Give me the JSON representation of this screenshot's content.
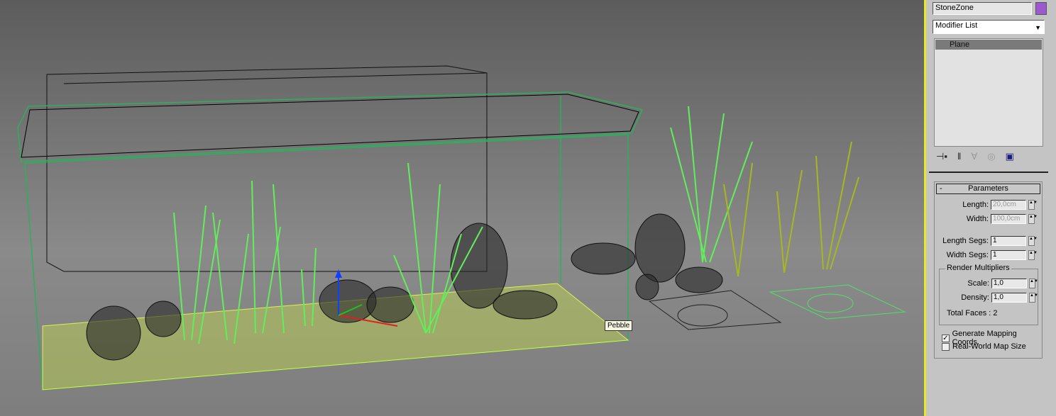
{
  "viewport": {
    "tooltip": "Pebble"
  },
  "panel": {
    "object_name": "StoneZone",
    "object_color": "#9b59d0",
    "modifier_list": "Modifier List",
    "stack": [
      "Plane"
    ],
    "toolbar_icons": [
      "pin-stack-icon",
      "show-end-result-icon",
      "make-unique-icon",
      "remove-modifier-icon",
      "configure-modifier-sets-icon"
    ],
    "parameters": {
      "title": "Parameters",
      "collapse": "-",
      "length_label": "Length:",
      "length": "20,0cm",
      "width_label": "Width:",
      "width": "100,0cm",
      "length_segs_label": "Length Segs:",
      "length_segs": "1",
      "width_segs_label": "Width Segs:",
      "width_segs": "1",
      "render_group": "Render Multipliers",
      "scale_label": "Scale:",
      "scale": "1,0",
      "density_label": "Density:",
      "density": "1,0",
      "total_faces": "Total Faces : 2",
      "gen_mapping": "Generate Mapping Coords.",
      "gen_mapping_checked": true,
      "real_world": "Real-World Map Size",
      "real_world_checked": false
    }
  }
}
